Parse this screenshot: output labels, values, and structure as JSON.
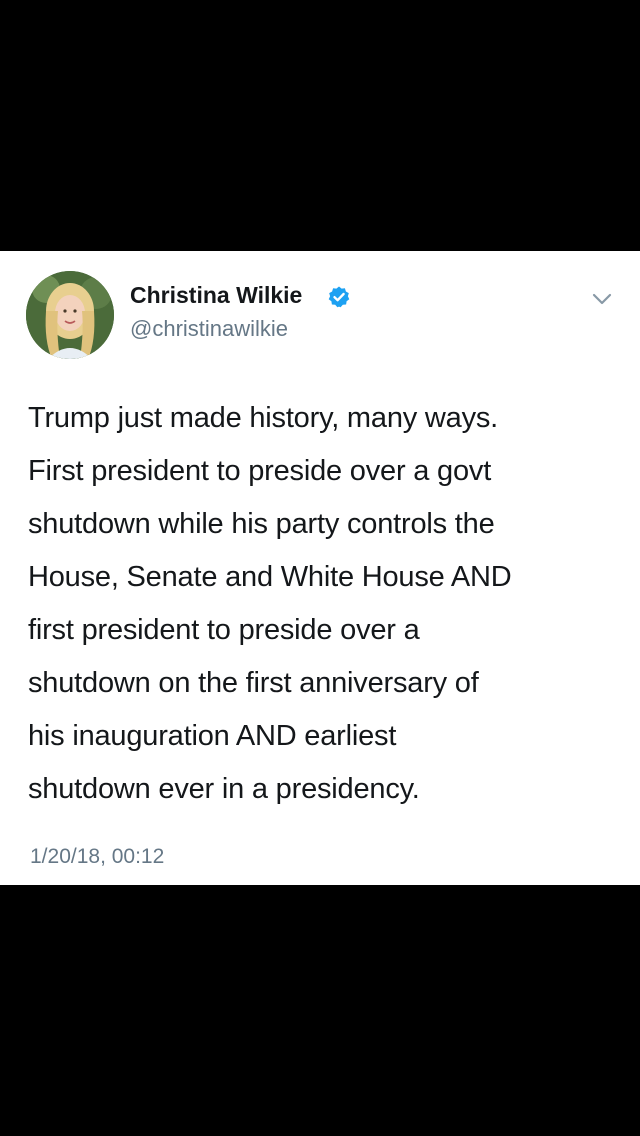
{
  "tweet": {
    "author": {
      "display_name": "Christina Wilkie",
      "handle": "@christinawilkie",
      "verified": true
    },
    "text_lines": [
      "Trump just made history, many ways.",
      "First president to preside over a govt",
      "shutdown while his party controls the",
      "House, Senate and White House AND",
      "first president to preside over a",
      "shutdown on the first anniversary of",
      "his inauguration AND earliest",
      "shutdown ever in a presidency."
    ],
    "timestamp": "1/20/18, 00:12"
  },
  "icons": {
    "verified": "verified-badge-icon",
    "menu": "chevron-down-icon"
  },
  "colors": {
    "background": "#000000",
    "card": "#ffffff",
    "text": "#14171a",
    "secondary_text": "#657786",
    "verified_blue": "#1da1f2"
  }
}
